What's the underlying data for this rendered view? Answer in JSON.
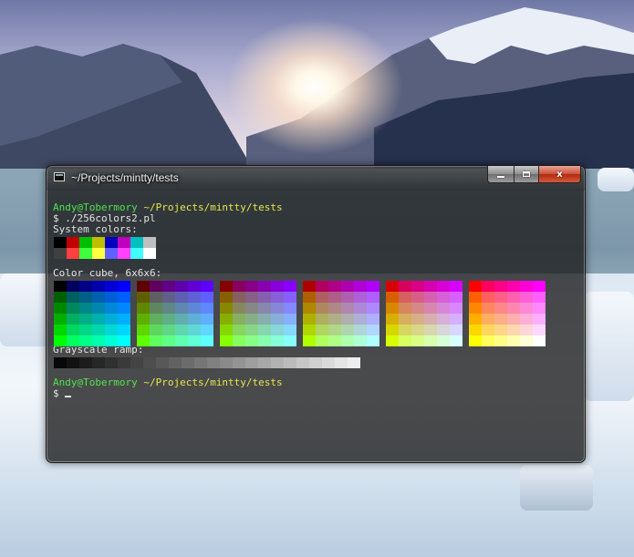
{
  "window": {
    "title": "~/Projects/mintty/tests",
    "buttons": {
      "minimize": "",
      "maximize": "",
      "close": "x"
    }
  },
  "terminal": {
    "prompt1": {
      "user": "Andy@Tobermory",
      "path": "~/Projects/mintty/tests"
    },
    "command": "$ ./256colors2.pl",
    "system_label": "System colors:",
    "cube_label": "Color cube, 6x6x6:",
    "gray_label": "Grayscale ramp:",
    "prompt2": {
      "user": "Andy@Tobermory",
      "path": "~/Projects/mintty/tests"
    },
    "prompt_symbol": "$ "
  },
  "colors": {
    "system_normal": [
      "#000000",
      "#bf0000",
      "#00bf00",
      "#bfbf00",
      "#0000bf",
      "#bf00bf",
      "#00bfbf",
      "#bfbfbf"
    ],
    "system_bright": [
      "#404040",
      "#ff4040",
      "#40ff40",
      "#ffff40",
      "#6060ff",
      "#ff40ff",
      "#40ffff",
      "#ffffff"
    ],
    "cube_levels": [
      0,
      95,
      135,
      175,
      215,
      255
    ],
    "gray_levels": [
      8,
      18,
      28,
      38,
      48,
      58,
      68,
      78,
      88,
      98,
      108,
      118,
      128,
      138,
      148,
      158,
      168,
      178,
      188,
      198,
      208,
      218,
      228,
      238
    ]
  }
}
